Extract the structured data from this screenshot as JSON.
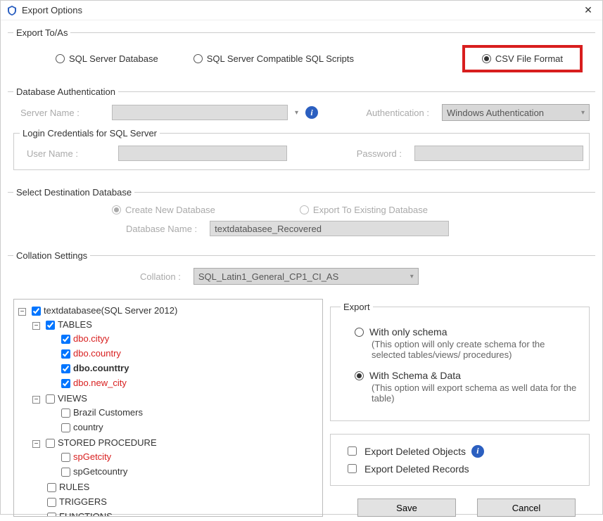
{
  "window": {
    "title": "Export Options",
    "close": "✕"
  },
  "fieldsets": {
    "exportTo": "Export To/As",
    "dbAuth": "Database Authentication",
    "loginCreds": "Login Credentials for SQL Server",
    "selectDest": "Select Destination Database",
    "collation": "Collation Settings",
    "export": "Export"
  },
  "exportTo": {
    "sqlDb": "SQL Server Database",
    "sqlScripts": "SQL Server Compatible SQL Scripts",
    "csv": "CSV File Format"
  },
  "dbAuth": {
    "serverNameLabel": "Server Name :",
    "authLabel": "Authentication :",
    "authValue": "Windows Authentication"
  },
  "login": {
    "userLabel": "User Name :",
    "passLabel": "Password :"
  },
  "dest": {
    "createNew": "Create New Database",
    "exportExisting": "Export To Existing Database",
    "dbNameLabel": "Database Name :",
    "dbNameValue": "textdatabasee_Recovered"
  },
  "collation": {
    "label": "Collation :",
    "value": "SQL_Latin1_General_CP1_CI_AS"
  },
  "tree": {
    "root": "textdatabasee(SQL Server 2012)",
    "tables": "TABLES",
    "t1": "dbo.cityy",
    "t2": "dbo.country",
    "t3": "dbo.counttry",
    "t4": "dbo.new_city",
    "views": "VIEWS",
    "v1": "Brazil Customers",
    "v2": "country",
    "sp": "STORED PROCEDURE",
    "sp1": "spGetcity",
    "sp2": "spGetcountry",
    "rules": "RULES",
    "triggers": "TRIGGERS",
    "functions": "FUNCTIONS"
  },
  "exportOpts": {
    "onlySchema": "With only schema",
    "onlySchemaDesc": "(This option will only create schema for the  selected tables/views/ procedures)",
    "schemaData": "With Schema & Data",
    "schemaDataDesc": "(This option will export schema as well data for the table)",
    "delObjects": "Export Deleted Objects",
    "delRecords": "Export Deleted Records"
  },
  "buttons": {
    "save": "Save",
    "cancel": "Cancel"
  }
}
